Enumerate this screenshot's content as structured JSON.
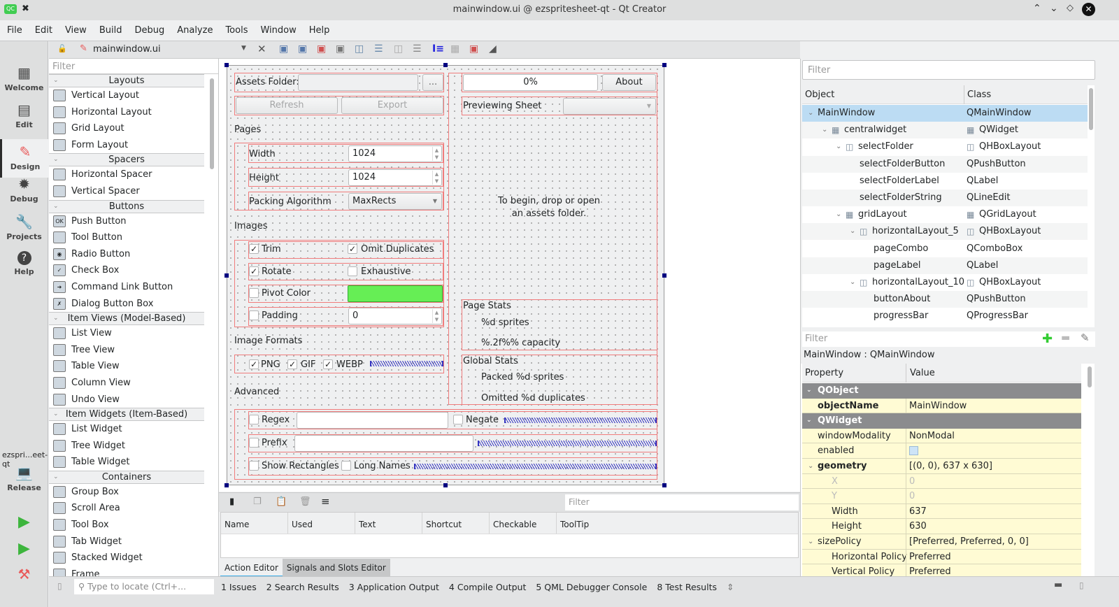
{
  "window": {
    "title": "mainwindow.ui @ ezspritesheet-qt - Qt Creator",
    "app_icon": "qt-creator-logo",
    "controls": [
      "keep-above-icon",
      "minimize-icon",
      "maximize-icon",
      "close-icon"
    ]
  },
  "menubar": [
    "File",
    "Edit",
    "View",
    "Build",
    "Debug",
    "Analyze",
    "Tools",
    "Window",
    "Help"
  ],
  "modes": [
    {
      "label": "Welcome",
      "icon": "grid-icon"
    },
    {
      "label": "Edit",
      "icon": "document-icon"
    },
    {
      "label": "Design",
      "icon": "pencil-icon",
      "active": true
    },
    {
      "label": "Debug",
      "icon": "bug-icon"
    },
    {
      "label": "Projects",
      "icon": "wrench-icon"
    },
    {
      "label": "Help",
      "icon": "question-icon"
    }
  ],
  "kit": {
    "project": "ezspri...eet-qt",
    "config": "Release"
  },
  "editor": {
    "file": "mainwindow.ui"
  },
  "widgetbox": {
    "filter_placeholder": "Filter",
    "categories": [
      {
        "name": "Layouts",
        "items": [
          "Vertical Layout",
          "Horizontal Layout",
          "Grid Layout",
          "Form Layout"
        ]
      },
      {
        "name": "Spacers",
        "items": [
          "Horizontal Spacer",
          "Vertical Spacer"
        ]
      },
      {
        "name": "Buttons",
        "items": [
          "Push Button",
          "Tool Button",
          "Radio Button",
          "Check Box",
          "Command Link Button",
          "Dialog Button Box"
        ]
      },
      {
        "name": "Item Views (Model-Based)",
        "items": [
          "List View",
          "Tree View",
          "Table View",
          "Column View",
          "Undo View"
        ]
      },
      {
        "name": "Item Widgets (Item-Based)",
        "items": [
          "List Widget",
          "Tree Widget",
          "Table Widget"
        ]
      },
      {
        "name": "Containers",
        "items": [
          "Group Box",
          "Scroll Area",
          "Tool Box",
          "Tab Widget",
          "Stacked Widget",
          "Frame"
        ]
      }
    ]
  },
  "form": {
    "assets_label": "Assets Folder:",
    "assets_value": "",
    "browse_label": "...",
    "refresh_label": "Refresh",
    "export_label": "Export",
    "pages_heading": "Pages",
    "width_label": "Width",
    "width_value": "1024",
    "height_label": "Height",
    "height_value": "1024",
    "packing_label": "Packing Algorithm",
    "packing_value": "MaxRects",
    "images_heading": "Images",
    "trim": {
      "label": "Trim",
      "checked": true
    },
    "omit": {
      "label": "Omit Duplicates",
      "checked": true
    },
    "rotate": {
      "label": "Rotate",
      "checked": true
    },
    "exhaustive": {
      "label": "Exhaustive",
      "checked": false
    },
    "pivot": {
      "label": "Pivot Color",
      "checked": false,
      "color": "#66ee55"
    },
    "padding": {
      "label": "Padding",
      "checked": false,
      "value": "0"
    },
    "formats_heading": "Image Formats",
    "png": {
      "label": "PNG",
      "checked": true
    },
    "gif": {
      "label": "GIF",
      "checked": true
    },
    "webp": {
      "label": "WEBP",
      "checked": true
    },
    "advanced_heading": "Advanced",
    "regex": {
      "label": "Regex",
      "checked": false,
      "value": ""
    },
    "negate": {
      "label": "Negate",
      "checked": false
    },
    "prefix": {
      "label": "Prefix",
      "checked": false,
      "value": ""
    },
    "show_rects": {
      "label": "Show Rectangles",
      "checked": false
    },
    "long_names": {
      "label": "Long Names",
      "checked": false
    },
    "progress": "0%",
    "progress_value": 0,
    "about_label": "About",
    "previewing_label": "Previewing Sheet",
    "previewing_value": "",
    "drop_hint": "To begin, drop or open\nan assets folder.",
    "page_stats_heading": "Page Stats",
    "page_sprites": "%d sprites",
    "page_capacity": "%.2f%% capacity",
    "global_stats_heading": "Global Stats",
    "packed": "Packed %d sprites",
    "omitted": "Omitted %d duplicates"
  },
  "action_editor": {
    "filter_placeholder": "Filter",
    "columns": [
      "Name",
      "Used",
      "Text",
      "Shortcut",
      "Checkable",
      "ToolTip"
    ],
    "tabs": [
      {
        "label": "Action Editor",
        "active": true
      },
      {
        "label": "Signals and Slots Editor"
      }
    ]
  },
  "statusbar": {
    "locate_placeholder": "Type to locate (Ctrl+...",
    "panes": [
      "1  Issues",
      "2  Search Results",
      "3  Application Output",
      "4  Compile Output",
      "5  QML Debugger Console",
      "8  Test Results"
    ]
  },
  "object_inspector": {
    "filter_placeholder": "Filter",
    "columns": [
      "Object",
      "Class"
    ],
    "rows": [
      {
        "name": "MainWindow",
        "class": "QMainWindow",
        "depth": 0,
        "expander": true,
        "selected": true
      },
      {
        "name": "centralwidget",
        "class": "QWidget",
        "depth": 1,
        "expander": true,
        "icon": "grid"
      },
      {
        "name": "selectFolder",
        "class": "QHBoxLayout",
        "depth": 2,
        "expander": true,
        "icon": "hbox"
      },
      {
        "name": "selectFolderButton",
        "class": "QPushButton",
        "depth": 3
      },
      {
        "name": "selectFolderLabel",
        "class": "QLabel",
        "depth": 3
      },
      {
        "name": "selectFolderString",
        "class": "QLineEdit",
        "depth": 3
      },
      {
        "name": "gridLayout",
        "class": "QGridLayout",
        "depth": 2,
        "expander": true,
        "icon": "grid"
      },
      {
        "name": "horizontalLayout_5",
        "class": "QHBoxLayout",
        "depth": 3,
        "expander": true,
        "icon": "hbox"
      },
      {
        "name": "pageCombo",
        "class": "QComboBox",
        "depth": 4
      },
      {
        "name": "pageLabel",
        "class": "QLabel",
        "depth": 4
      },
      {
        "name": "horizontalLayout_10",
        "class": "QHBoxLayout",
        "depth": 3,
        "expander": true,
        "icon": "hbox"
      },
      {
        "name": "buttonAbout",
        "class": "QPushButton",
        "depth": 4
      },
      {
        "name": "progressBar",
        "class": "QProgressBar",
        "depth": 4
      }
    ]
  },
  "property_editor": {
    "filter_placeholder": "Filter",
    "object_label": "MainWindow : QMainWindow",
    "columns": [
      "Property",
      "Value"
    ],
    "rows": [
      {
        "type": "cat",
        "name": "QObject"
      },
      {
        "name": "objectName",
        "value": "MainWindow",
        "bold": true,
        "indent": 1
      },
      {
        "type": "cat",
        "name": "QWidget"
      },
      {
        "name": "windowModality",
        "value": "NonModal",
        "indent": 1
      },
      {
        "name": "enabled",
        "value": "",
        "checkbox": true,
        "indent": 1
      },
      {
        "name": "geometry",
        "value": "[(0, 0), 637 x 630]",
        "bold": true,
        "indent": 1,
        "expander": true
      },
      {
        "name": "X",
        "value": "0",
        "indent": 2,
        "dim": true
      },
      {
        "name": "Y",
        "value": "0",
        "indent": 2,
        "dim": true
      },
      {
        "name": "Width",
        "value": "637",
        "indent": 2
      },
      {
        "name": "Height",
        "value": "630",
        "indent": 2
      },
      {
        "name": "sizePolicy",
        "value": "[Preferred, Preferred, 0, 0]",
        "indent": 1,
        "expander": true
      },
      {
        "name": "Horizontal Policy",
        "value": "Preferred",
        "indent": 2
      },
      {
        "name": "Vertical Policy",
        "value": "Preferred",
        "indent": 2
      }
    ]
  }
}
